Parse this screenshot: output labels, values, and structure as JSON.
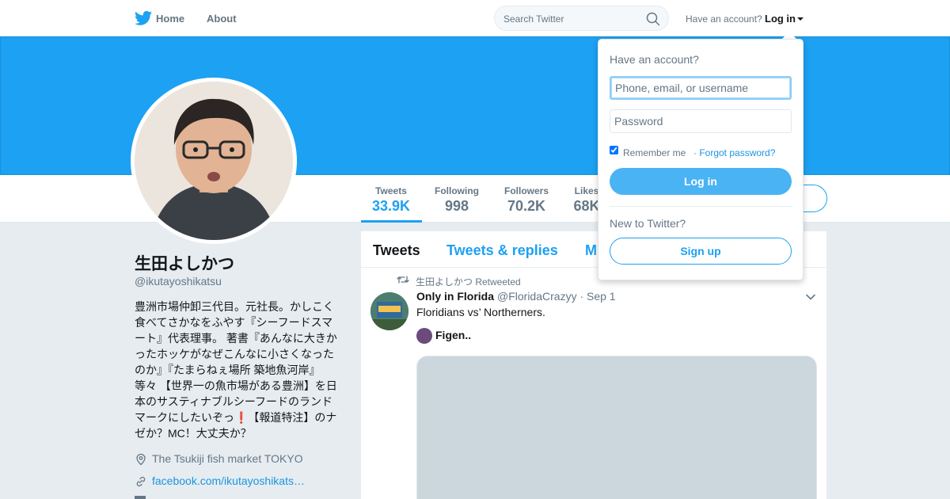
{
  "nav": {
    "home": "Home",
    "about": "About",
    "search_placeholder": "Search Twitter",
    "have_account": "Have an account?",
    "login": "Log in"
  },
  "stats": [
    {
      "label": "Tweets",
      "value": "33.9K"
    },
    {
      "label": "Following",
      "value": "998"
    },
    {
      "label": "Followers",
      "value": "70.2K"
    },
    {
      "label": "Likes",
      "value": "68K"
    }
  ],
  "profile": {
    "name": "生田よしかつ",
    "handle": "@ikutayoshikatsu",
    "bio": "豊洲市場仲卸三代目。元社長。かしこく食べてさかなをふやす『シーフードスマート』代表理事。 著書『あんなに大きかったホッケがなぜこんなに小さくなったのか』『たまらねぇ場所 築地魚河岸』等々 【世界一の魚市場がある豊洲】を日本のサスティナブルシーフードのランドマークにしたいぞっ❗️【報道特注】のナゼか？MC！大丈夫か？",
    "location": "The Tsukiji fish market TOKYO",
    "website": "facebook.com/ikutayoshikats…"
  },
  "timeline": {
    "tabs": [
      "Tweets",
      "Tweets & replies",
      "M"
    ],
    "retweet_context": "生田よしかつ Retweeted",
    "tweet": {
      "name": "Only in Florida",
      "handle_date": "@FloridaCrazyy · Sep 1",
      "text": "Floridians vs’ Northerners.",
      "quoted_name": "Figen.."
    }
  },
  "login_dropdown": {
    "title": "Have an account?",
    "username_placeholder": "Phone, email, or username",
    "password_placeholder": "Password",
    "remember": "Remember me",
    "forgot": "· Forgot password?",
    "login_button": "Log in",
    "new_to": "New to Twitter?",
    "signup_button": "Sign up"
  },
  "colors": {
    "brand": "#1da1f2",
    "banner": "#1da1f2",
    "login_button": "#4ab3f4"
  }
}
